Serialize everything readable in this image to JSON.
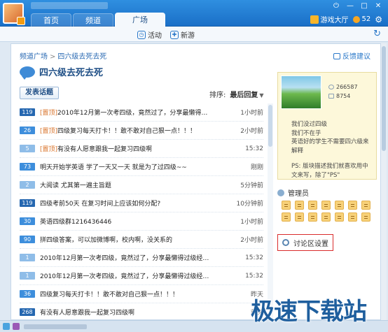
{
  "tabs": [
    "首页",
    "频道",
    "广场"
  ],
  "top_right": {
    "game_hall": "游戏大厅",
    "coins": "52"
  },
  "subnav": {
    "activity": "活动",
    "new_games": "新游"
  },
  "breadcrumb": {
    "root": "频道广场",
    "current": "四六级去死去死"
  },
  "feedback_label": "反馈建议",
  "page_title": "四六级去死去死",
  "post_button": "发表话题",
  "sort": {
    "label": "排序:",
    "value": "最后回复"
  },
  "posts": [
    {
      "count": "119",
      "tag": "[置顶]",
      "title": "2010年12月第一次考四级，竟然过了，分享最懒得…",
      "time": "1小时前"
    },
    {
      "count": "26",
      "tag": "[置顶]",
      "title": "四级复习每天打卡！！敢不敢对自己狠一点！！！",
      "time": "2小时前"
    },
    {
      "count": "5",
      "tag": "[置顶]",
      "title": "有没有人愿意跟我一起复习四级啊",
      "time": "15:32"
    },
    {
      "count": "73",
      "tag": "",
      "title": "明天开始学英语 学了一天又一天 就是为了过四级~~",
      "time": "刚刚"
    },
    {
      "count": "2",
      "tag": "",
      "title": "大阅读 尤其第一遍主旨题",
      "time": "5分钟前"
    },
    {
      "count": "119",
      "tag": "",
      "title": "四级考前50天 在复习时间上应该如何分配?",
      "time": "10分钟前"
    },
    {
      "count": "30",
      "tag": "",
      "title": "英语四级群1216436446",
      "time": "1小时前"
    },
    {
      "count": "90",
      "tag": "",
      "title": "拼四级答案，可以加微博啊，校内啊，没关系的",
      "time": "2小时前"
    },
    {
      "count": "1",
      "tag": "",
      "title": "2010年12月第一次考四级，竟然过了，分享最懒得过级经…",
      "time": "15:32"
    },
    {
      "count": "1",
      "tag": "",
      "title": "2010年12月第一次考四级，竟然过了，分享最懒得过级经…",
      "time": "15:32"
    },
    {
      "count": "36",
      "tag": "",
      "title": "四级复习每天打卡！！敢不敢对自己狠一点！！！",
      "time": "昨天"
    },
    {
      "count": "268",
      "tag": "",
      "title": "有没有人愿意跟我一起复习四级啊",
      "time": "前天"
    }
  ],
  "channel_stats": {
    "views": "266587",
    "posts": "8754"
  },
  "channel_desc": [
    "我们没过四级",
    "我们不在乎",
    "英语好的学生不需要四六级来解释",
    "",
    "PS: 版块描述我们就喜欢用中文来写，除了\"PS\""
  ],
  "admin_label": "管理员",
  "admin_count": 14,
  "settings_label": "讨论区设置",
  "watermark": "极速下载站"
}
